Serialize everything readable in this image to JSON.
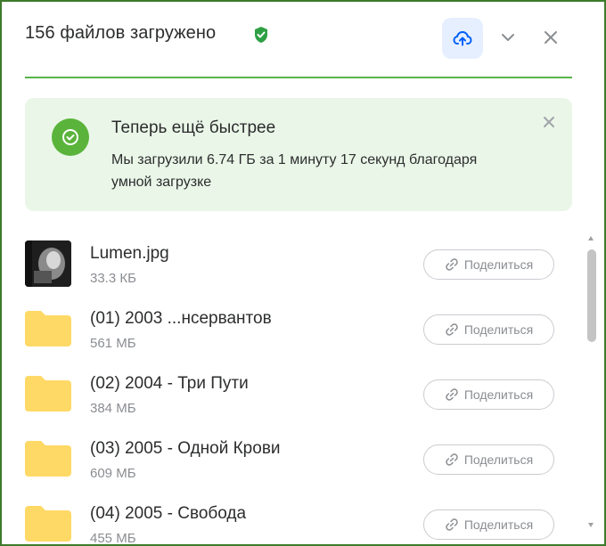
{
  "header": {
    "title": "156 файлов загружено",
    "icons": {
      "verified": "shield-check-icon",
      "upload": "cloud-upload-icon",
      "collapse": "chevron-down-icon",
      "close": "close-icon"
    }
  },
  "banner": {
    "title": "Теперь ещё быстрее",
    "text": "Мы загрузили 6.74 ГБ за 1 минуту 17 секунд благодаря умной загрузке",
    "icon": "check-circle-icon"
  },
  "files": [
    {
      "name": "Lumen.jpg",
      "size": "33.3 КБ",
      "type": "image",
      "share_label": "Поделиться"
    },
    {
      "name": "(01) 2003 ...нсервантов",
      "size": "561 МБ",
      "type": "folder",
      "share_label": "Поделиться"
    },
    {
      "name": "(02) 2004 - Три Пути",
      "size": "384 МБ",
      "type": "folder",
      "share_label": "Поделиться"
    },
    {
      "name": "(03) 2005 - Одной Крови",
      "size": "609 МБ",
      "type": "folder",
      "share_label": "Поделиться"
    },
    {
      "name": "(04) 2005 - Свобода",
      "size": "455 МБ",
      "type": "folder",
      "share_label": "Поделиться"
    }
  ],
  "colors": {
    "accent_green": "#5ab43b",
    "divider": "#57b548",
    "banner_bg": "#eaf7e8",
    "upload_btn_bg": "#e5efff",
    "folder": "#ffd966"
  }
}
